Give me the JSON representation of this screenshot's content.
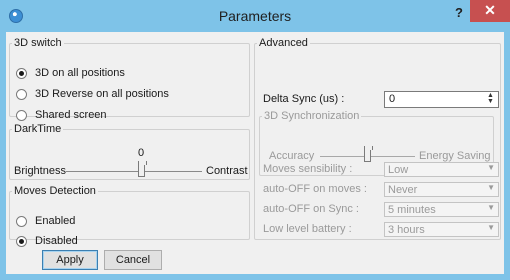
{
  "window": {
    "title": "Parameters",
    "help_glyph": "?",
    "close_glyph": "✕"
  },
  "switch_3d": {
    "legend": "3D switch",
    "options": [
      {
        "label": "3D on all positions",
        "checked": true
      },
      {
        "label": "3D Reverse on all positions",
        "checked": false
      },
      {
        "label": "Shared screen",
        "checked": false
      }
    ]
  },
  "darktime": {
    "legend": "DarkTime",
    "value": "0",
    "left_label": "Brightness",
    "right_label": "Contrast"
  },
  "moves_detection": {
    "legend": "Moves Detection",
    "options": [
      {
        "label": "Enabled",
        "checked": false
      },
      {
        "label": "Disabled",
        "checked": true
      }
    ]
  },
  "advanced": {
    "legend": "Advanced",
    "delta_sync_label": "Delta Sync (us) :",
    "delta_sync_value": "0",
    "sync3d_legend": "3D Synchronization",
    "accuracy_label": "Accuracy",
    "energy_label": "Energy Saving",
    "settings": [
      {
        "label": "Moves sensibility :",
        "value": "Low"
      },
      {
        "label": "auto-OFF on moves :",
        "value": "Never"
      },
      {
        "label": "auto-OFF on Sync :",
        "value": "5 minutes"
      },
      {
        "label": "Low level battery :",
        "value": "3 hours"
      }
    ]
  },
  "buttons": {
    "apply": "Apply",
    "cancel": "Cancel"
  }
}
